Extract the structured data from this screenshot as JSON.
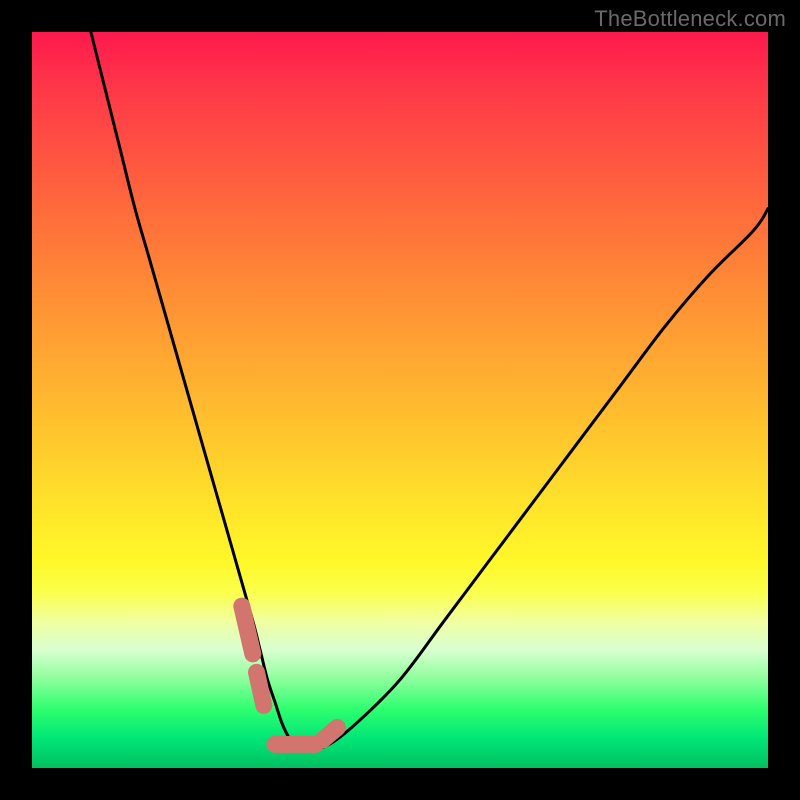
{
  "watermark": "TheBottleneck.com",
  "chart_data": {
    "type": "line",
    "title": "",
    "xlabel": "",
    "ylabel": "",
    "xlim": [
      0,
      100
    ],
    "ylim": [
      0,
      100
    ],
    "grid": false,
    "legend": false,
    "series": [
      {
        "name": "bottleneck-curve",
        "color": "#000000",
        "x": [
          8,
          10,
          12,
          14,
          16,
          18,
          20,
          22,
          24,
          26,
          28,
          30,
          31,
          32,
          33,
          34,
          35,
          36,
          37,
          38,
          40,
          44,
          50,
          56,
          62,
          68,
          74,
          80,
          86,
          92,
          98,
          100
        ],
        "values": [
          100,
          92,
          84,
          76,
          69,
          62,
          55,
          48,
          41,
          34,
          27,
          20,
          16,
          12,
          9,
          6,
          4,
          3,
          3,
          3,
          3,
          6,
          12,
          20,
          28,
          36,
          44,
          52,
          60,
          67,
          73,
          76
        ]
      },
      {
        "name": "highlight-markers",
        "color": "#d2756f",
        "type": "segments",
        "segments": [
          {
            "x": [
              28.5,
              30.0
            ],
            "y": [
              22.0,
              15.5
            ]
          },
          {
            "x": [
              30.5,
              31.5
            ],
            "y": [
              13.0,
              8.5
            ]
          },
          {
            "x": [
              33.0,
              38.5
            ],
            "y": [
              3.2,
              3.2
            ]
          },
          {
            "x": [
              39.5,
              41.5
            ],
            "y": [
              3.8,
              5.5
            ]
          }
        ]
      }
    ],
    "background_gradient": {
      "top": "#ff1a4d",
      "mid": "#ffe82a",
      "bottom": "#00c060"
    }
  }
}
